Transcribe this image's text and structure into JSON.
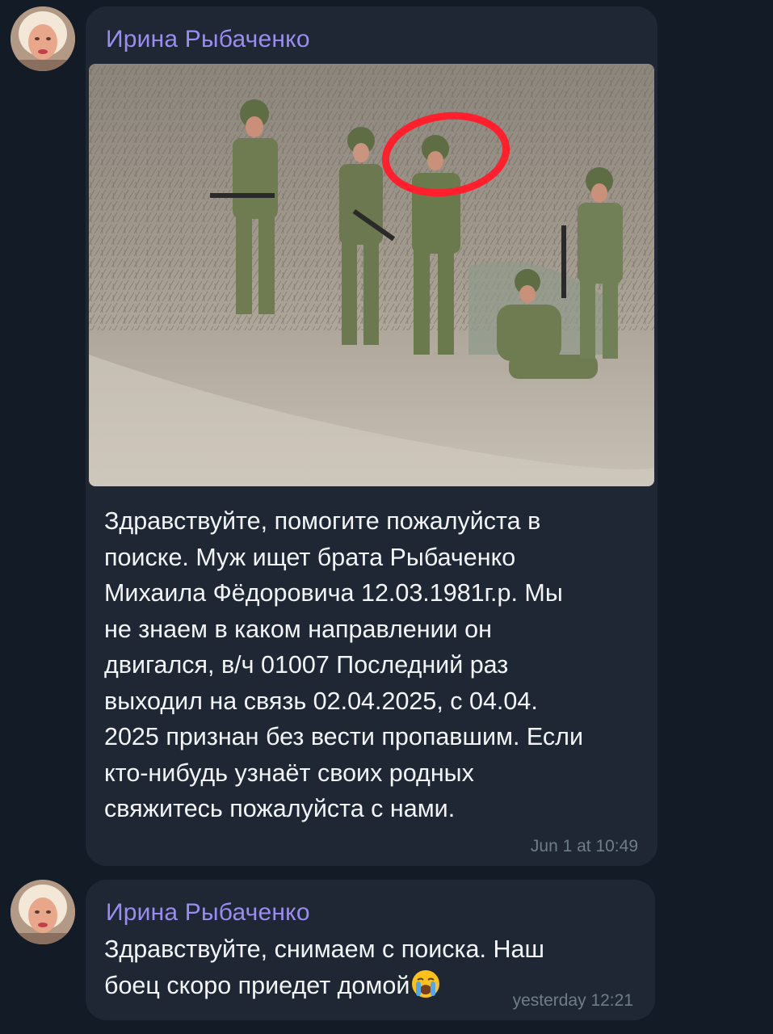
{
  "messages": [
    {
      "sender": "Ирина Рыбаченко",
      "text": "Здравствуйте, помогите пожалуйста в\nпоиске. Муж ищет брата Рыбаченко\nМихаила Фёдоровича 12.03.1981г.р. Мы\nне знаем в каком направлении он\nдвигался, в/ч 01007 Последний раз\nвыходил на связь 02.04.2025, с 04.04.\n2025 признан без вести пропавшим. Если\nкто-нибудь узнаёт своих родных\nсвяжитесь пожалуйста с нами.",
      "time": "Jun 1 at 10:49",
      "attachment": "photo-soldiers-group",
      "highlight_color": "#ff1f2d"
    },
    {
      "sender": "Ирина Рыбаченко",
      "text_line1": "Здравствуйте, снимаем с поиска. Наш",
      "text_line2": "боец скоро приедет домой",
      "emoji": "crying-face-emoji",
      "time": "yesterday 12:21"
    }
  ],
  "colors": {
    "background": "#121b26",
    "bubble": "#1e2733",
    "sender": "#9b8cf2",
    "text": "#f2f4f6",
    "time": "#6f7c8b"
  }
}
